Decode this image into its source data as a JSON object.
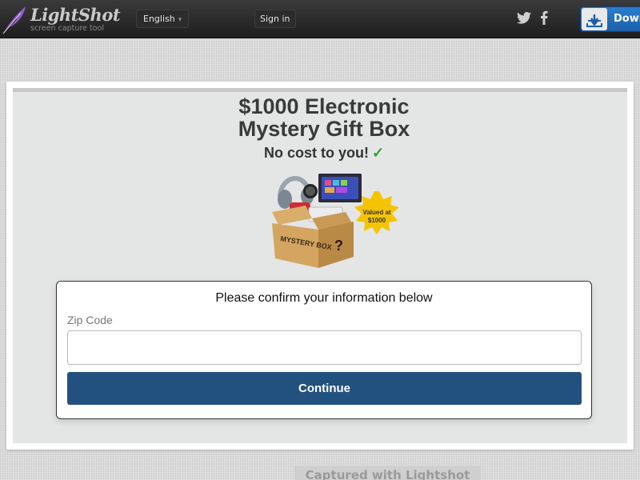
{
  "header": {
    "logo_title": "LightShot",
    "logo_subtitle": "screen capture tool",
    "language_label": "English",
    "signin_label": "Sign in",
    "download_label": "Download",
    "icons": [
      "feather-icon",
      "twitter-icon",
      "facebook-icon",
      "download-icon"
    ],
    "colors": {
      "bar": "#262626",
      "download_accent": "#1f6bbd"
    }
  },
  "screenshot": {
    "headline": "$1000 Electronic Mystery Gift Box",
    "subline": "No cost to you!",
    "check_mark": "✓",
    "badge_text_line1": "Valued at",
    "badge_text_line2": "$1000",
    "box_label": "MYSTERY BOX",
    "form": {
      "title": "Please confirm your information below",
      "zip_label": "Zip Code",
      "zip_value": "",
      "zip_placeholder": "",
      "continue_label": "Continue"
    },
    "colors": {
      "continue_button": "#23517f",
      "check": "#2f9e2f",
      "badge": "#f5c400"
    }
  },
  "footer": {
    "captured_label": "Captured with Lightshot"
  }
}
